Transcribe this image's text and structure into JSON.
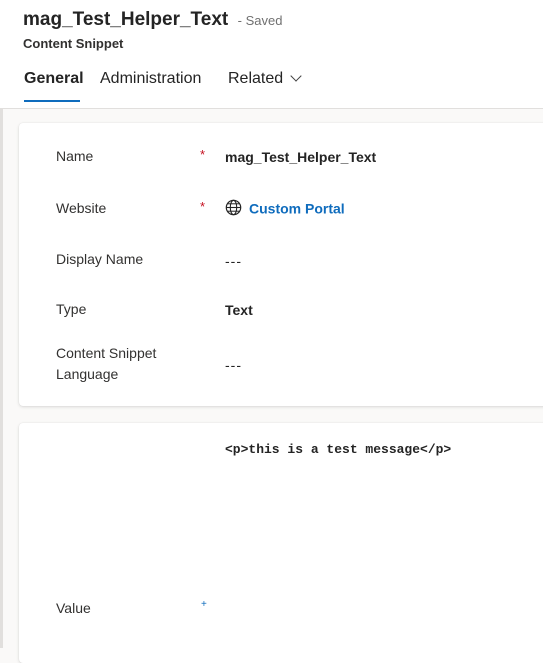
{
  "header": {
    "title": "mag_Test_Helper_Text",
    "status": "- Saved",
    "entity": "Content Snippet"
  },
  "tabs": [
    {
      "label": "General",
      "active": true
    },
    {
      "label": "Administration",
      "active": false
    },
    {
      "label": "Related",
      "active": false,
      "icon": "chevron-down-icon"
    }
  ],
  "form": {
    "required_marker": "*",
    "fields": {
      "name": {
        "label": "Name",
        "value": "mag_Test_Helper_Text"
      },
      "website": {
        "label": "Website",
        "value": "Custom Portal",
        "icon": "globe-icon"
      },
      "display_name": {
        "label": "Display Name",
        "value": "---"
      },
      "type": {
        "label": "Type",
        "value": "Text"
      },
      "language": {
        "label": "Content Snippet Language",
        "value": "---"
      }
    },
    "value_field": {
      "label": "Value",
      "content": "<p>this is a test message</p>",
      "marker": "+"
    }
  },
  "colors": {
    "link": "#0f6cbd",
    "required": "#c50f1f",
    "accent": "#0f6cbd"
  }
}
